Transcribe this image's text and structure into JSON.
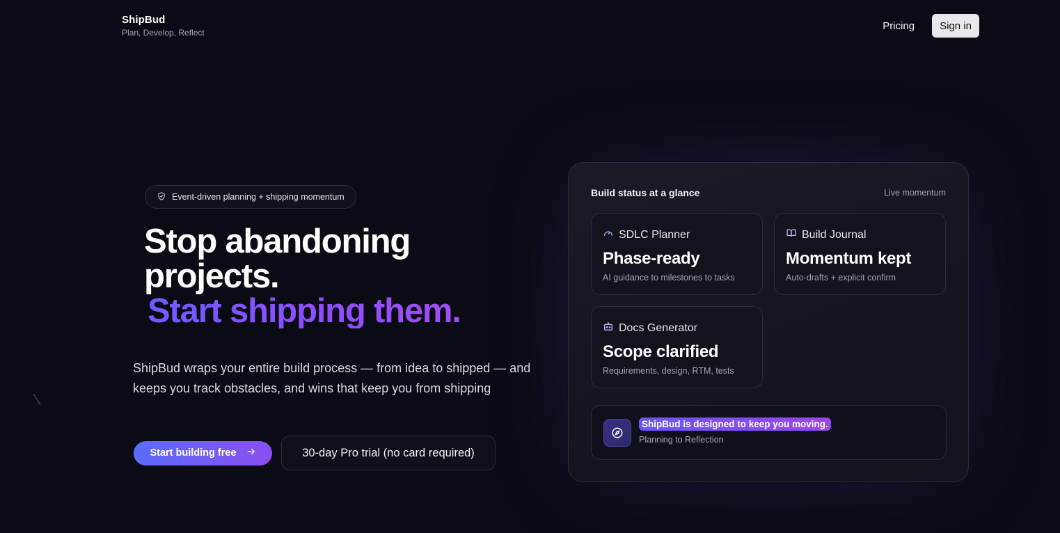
{
  "header": {
    "brand_name": "ShipBud",
    "brand_tagline": "Plan, Develop, Reflect",
    "nav_pricing": "Pricing",
    "nav_signin": "Sign in"
  },
  "hero": {
    "badge_icon": "shield-icon",
    "badge_text": "Event-driven planning + shipping momentum",
    "headline_line1": "Stop abandoning",
    "headline_line2": "projects.",
    "headline_accent": "Start shipping them.",
    "description": "ShipBud wraps your entire build process — from idea to shipped — and keeps you track obstacles, and wins that keep you from shipping",
    "cta_primary": "Start building free",
    "cta_primary_icon": "arrow-right-icon",
    "cta_secondary": "30-day Pro trial (no card required)"
  },
  "panel": {
    "title": "Build status at a glance",
    "live_label": "Live momentum",
    "cards": [
      {
        "icon": "gauge-icon",
        "name": "SDLC Planner",
        "value": "Phase-ready",
        "sub": "AI guidance to milestones to tasks"
      },
      {
        "icon": "book-icon",
        "name": "Build Journal",
        "value": "Momentum kept",
        "sub": "Auto-drafts + explicit confirm"
      },
      {
        "icon": "robot-icon",
        "name": "Docs Generator",
        "value": "Scope clarified",
        "sub": "Requirements, design, RTM, tests"
      }
    ],
    "note": {
      "icon": "compass-icon",
      "title": "ShipBud is designed to keep you moving.",
      "sub": "Planning to Reflection"
    }
  },
  "colors": {
    "background": "#0a0b14",
    "accent_start": "#6b5cff",
    "accent_end": "#a04ef2",
    "signin_bg": "#e9e9ec"
  }
}
